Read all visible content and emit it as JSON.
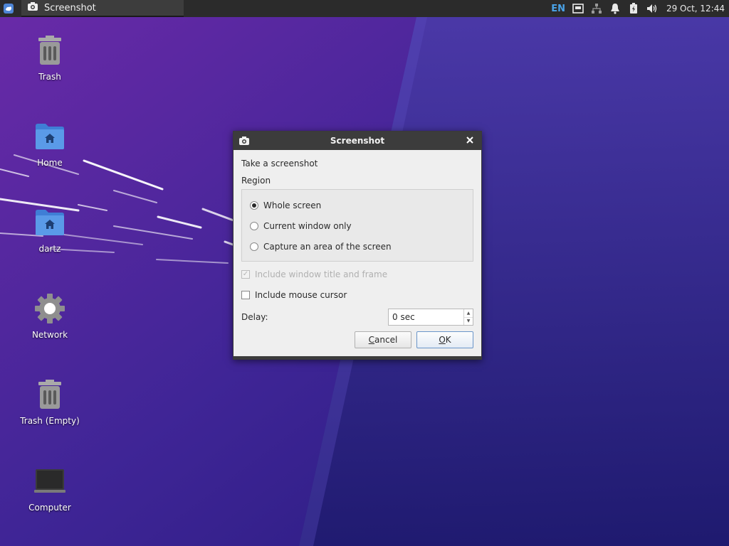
{
  "panel": {
    "task_title": "Screenshot",
    "language": "EN",
    "clock": "29 Oct, 12:44"
  },
  "desktop": {
    "icons": [
      {
        "label": "Trash",
        "icon": "trash-icon"
      },
      {
        "label": "Home",
        "icon": "folder-home-icon"
      },
      {
        "label": "dartz",
        "icon": "folder-home-icon"
      },
      {
        "label": "Network",
        "icon": "network-gear-icon"
      },
      {
        "label": "Trash (Empty)",
        "icon": "trash-icon"
      },
      {
        "label": "Computer",
        "icon": "computer-icon"
      }
    ]
  },
  "dialog": {
    "title": "Screenshot",
    "heading": "Take a screenshot",
    "region_label": "Region",
    "region_options": [
      {
        "label": "Whole screen",
        "selected": true
      },
      {
        "label": "Current window only",
        "selected": false
      },
      {
        "label": "Capture an area of the screen",
        "selected": false
      }
    ],
    "include_frame": {
      "label": "Include window title and frame",
      "checked": true,
      "enabled": false
    },
    "include_cursor": {
      "label": "Include mouse cursor",
      "checked": false,
      "enabled": true
    },
    "delay_label": "Delay:",
    "delay_value": "0 sec",
    "cancel_prefix": "",
    "cancel_mnemonic": "C",
    "cancel_rest": "ancel",
    "ok_mnemonic": "O",
    "ok_rest": "K"
  },
  "colors": {
    "panel_bg": "#2b2b2b",
    "accent": "#4aa3e8",
    "wallpaper_dark": "#2a1a7a",
    "wallpaper_light": "#5a2bb0"
  }
}
